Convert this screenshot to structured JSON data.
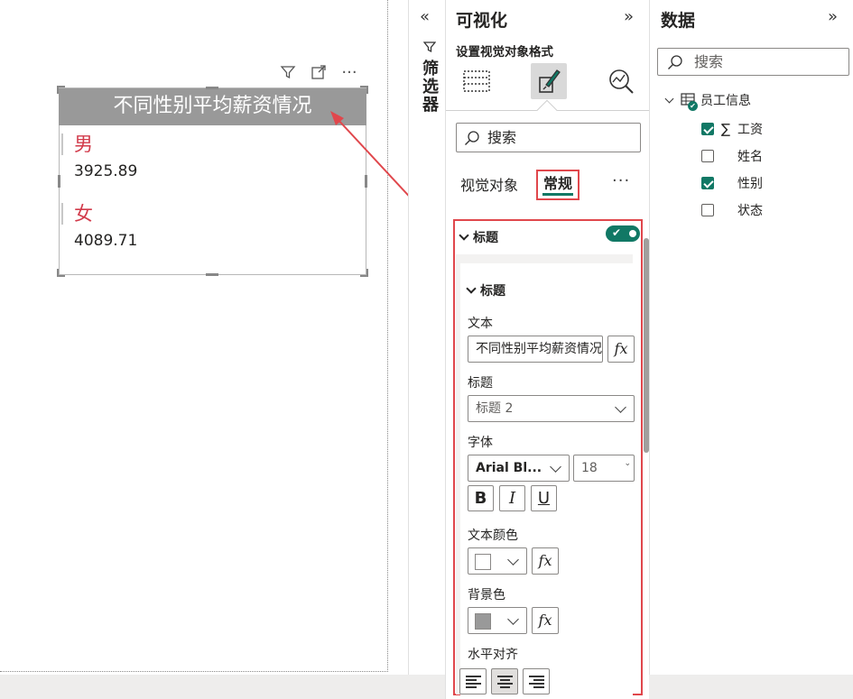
{
  "visual": {
    "title": "不同性别平均薪资情况",
    "rows": [
      {
        "category": "男",
        "value": "3925.89"
      },
      {
        "category": "女",
        "value": "4089.71"
      }
    ]
  },
  "filters": {
    "label": "筛选器"
  },
  "viz_pane": {
    "title": "可视化",
    "subtitle": "设置视觉对象格式",
    "search_placeholder": "搜索",
    "tabs": {
      "visual": "视觉对象",
      "general": "常规"
    },
    "more": "···",
    "section_title": "标题",
    "section_toggle_on": true,
    "sub_section_title": "标题",
    "text_label": "文本",
    "text_value": "不同性别平均薪资情况",
    "heading_label": "标题",
    "heading_value": "标题 2",
    "font_label": "字体",
    "font_family": "Arial Bl...",
    "font_size": "18",
    "bold": "B",
    "italic": "I",
    "underline": "U",
    "fx": "fx",
    "text_color_label": "文本颜色",
    "text_color": "#ffffff",
    "bg_color_label": "背景色",
    "bg_color": "#999999",
    "halign_label": "水平对齐"
  },
  "data_pane": {
    "title": "数据",
    "search_placeholder": "搜索",
    "table": "员工信息",
    "fields": [
      {
        "name": "工资",
        "checked": true,
        "sigma": true
      },
      {
        "name": "姓名",
        "checked": false,
        "sigma": false
      },
      {
        "name": "性别",
        "checked": true,
        "sigma": false
      },
      {
        "name": "状态",
        "checked": false,
        "sigma": false
      }
    ]
  },
  "colors": {
    "accent": "#117865",
    "highlight": "#e0474c",
    "category": "#d23b4b"
  }
}
